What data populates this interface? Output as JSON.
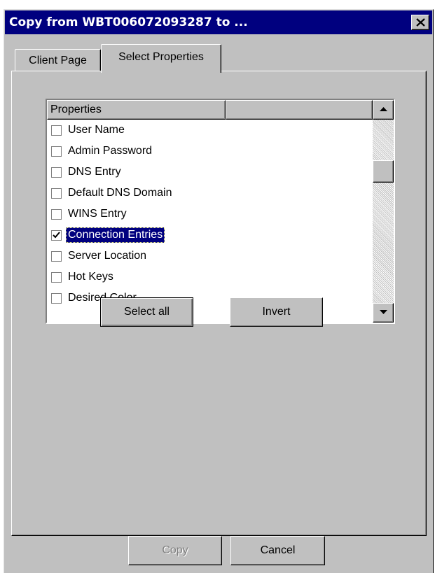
{
  "window": {
    "title": "Copy from WBT006072093287 to ..."
  },
  "tabs": [
    {
      "label": "Client Page",
      "active": false
    },
    {
      "label": "Select Properties",
      "active": true
    }
  ],
  "list": {
    "columns": [
      "Properties",
      ""
    ],
    "rows": [
      {
        "label": "User Name",
        "checked": false
      },
      {
        "label": "Admin Password",
        "checked": false
      },
      {
        "label": "DNS Entry",
        "checked": false
      },
      {
        "label": "Default DNS Domain",
        "checked": false
      },
      {
        "label": "WINS Entry",
        "checked": false
      },
      {
        "label": "Connection Entries",
        "checked": true,
        "selected": true
      },
      {
        "label": "Server Location",
        "checked": false
      },
      {
        "label": "Hot Keys",
        "checked": false
      },
      {
        "label": "Desired Color",
        "checked": false
      }
    ]
  },
  "buttons": {
    "select_all": "Select all",
    "invert": "Invert",
    "copy": "Copy",
    "cancel": "Cancel"
  },
  "icons": {
    "close": "close-icon",
    "scroll_up": "arrow-up-icon",
    "scroll_down": "arrow-down-icon",
    "check": "checkmark-icon"
  },
  "colors": {
    "titlebar": "#00007f",
    "face": "#c0c0c0",
    "selection": "#00007f"
  }
}
